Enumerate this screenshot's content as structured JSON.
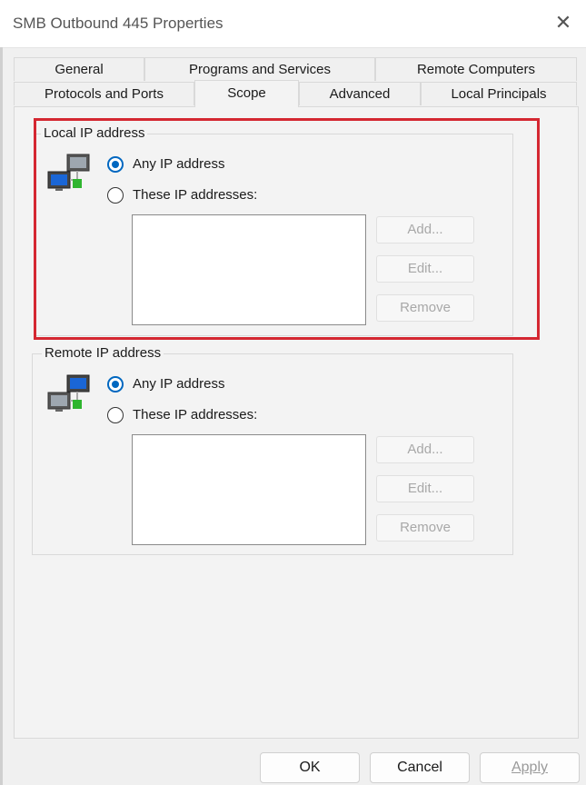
{
  "window": {
    "title": "SMB Outbound 445 Properties"
  },
  "tabs": {
    "general": "General",
    "programs": "Programs and Services",
    "remote_computers": "Remote Computers",
    "protocols": "Protocols and Ports",
    "scope": "Scope",
    "advanced": "Advanced",
    "local_principals": "Local Principals"
  },
  "local": {
    "group_label": "Local IP address",
    "any_label": "Any IP address",
    "these_label": "These IP addresses:",
    "add": "Add...",
    "edit": "Edit...",
    "remove": "Remove",
    "selected": "any"
  },
  "remote": {
    "group_label": "Remote IP address",
    "any_label": "Any IP address",
    "these_label": "These IP addresses:",
    "add": "Add...",
    "edit": "Edit...",
    "remove": "Remove",
    "selected": "any"
  },
  "footer": {
    "ok": "OK",
    "cancel": "Cancel",
    "apply": "Apply"
  },
  "colors": {
    "accent": "#0067c0",
    "highlight": "#d42731"
  }
}
